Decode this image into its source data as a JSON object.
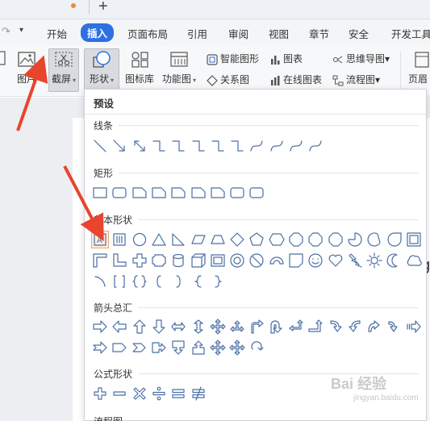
{
  "menu": {
    "tabs": [
      {
        "label": "开始"
      },
      {
        "label": "插入"
      },
      {
        "label": "页面布局"
      },
      {
        "label": "引用"
      },
      {
        "label": "审阅"
      },
      {
        "label": "视图"
      },
      {
        "label": "章节"
      },
      {
        "label": "安全"
      },
      {
        "label": "开发工具"
      }
    ],
    "active_tab": "插入",
    "accent_color": "#2f6fe4"
  },
  "ribbon": {
    "picture": "图片",
    "screenshot": "截屏",
    "shape": "形状",
    "icon_library": "图标库",
    "function_chart": "功能图",
    "smart_graphic": "智能图形",
    "chart": "图表",
    "mind_map": "思维导图",
    "relation_chart": "关系图",
    "online_chart": "在线图表",
    "flowchart": "流程图",
    "header_footer": "页眉"
  },
  "shapes_panel": {
    "title": "预设",
    "sections": [
      {
        "label": "线条",
        "count": 12
      },
      {
        "label": "矩形",
        "count": 9
      },
      {
        "label": "基本形状",
        "count": 42
      },
      {
        "label": "箭头总汇",
        "count": 28
      },
      {
        "label": "公式形状",
        "count": 6
      },
      {
        "label": "流程图",
        "count": 0
      }
    ],
    "selected_shape": "text-box-shape",
    "selection_color": "#f0a46a",
    "shape_color": "#4a6fa5"
  },
  "annotation_color": "#e8442e",
  "watermark": {
    "main": "Bai 经验",
    "sub": "jingyan.baidu.com"
  }
}
